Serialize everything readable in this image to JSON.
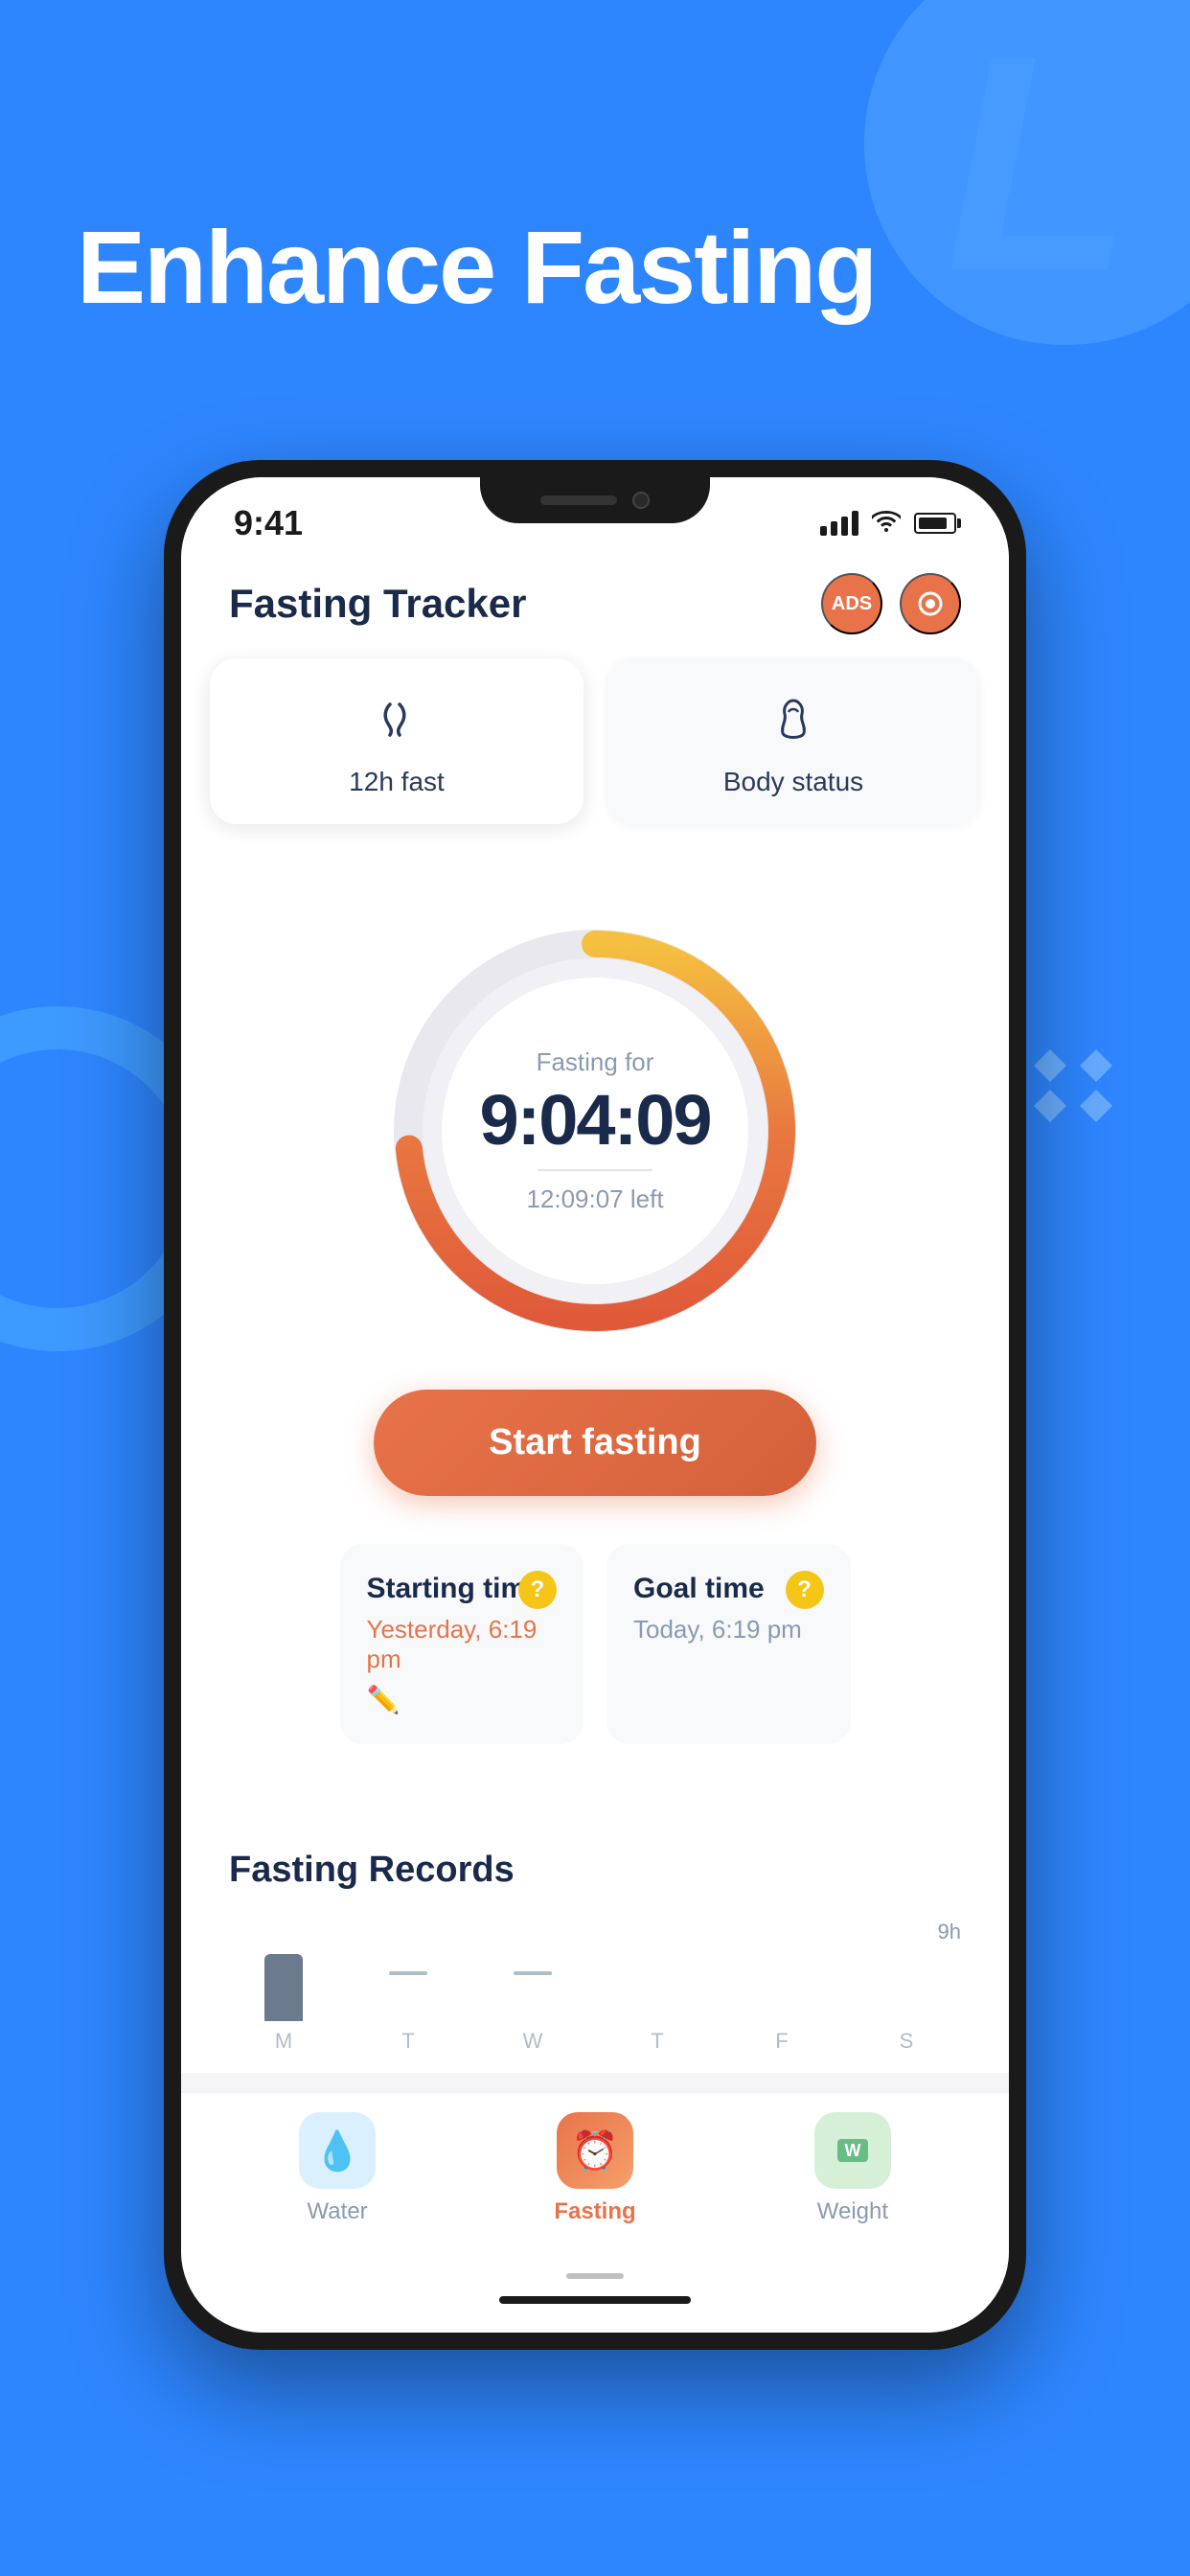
{
  "page": {
    "background_color": "#2E86FF",
    "title": "Enhance Fasting"
  },
  "header": {
    "app_title": "Fasting Tracker",
    "ads_button_label": "ADS",
    "record_button_label": "○"
  },
  "status_bar": {
    "time": "9:41",
    "signal": "●●●●",
    "wifi": "wifi",
    "battery": "battery"
  },
  "tabs": [
    {
      "id": "fast",
      "label": "12h fast",
      "icon": "⌛",
      "active": true
    },
    {
      "id": "body",
      "label": "Body status",
      "icon": "🌿",
      "active": false
    }
  ],
  "timer": {
    "label": "Fasting for",
    "time": "9:04:09",
    "left_label": "12:09:07 left"
  },
  "start_button": {
    "label": "Start fasting"
  },
  "time_cards": [
    {
      "title": "Starting time",
      "value": "Yesterday, 6:19 pm",
      "value_type": "orange",
      "has_edit": true,
      "has_question": true
    },
    {
      "title": "Goal time",
      "value": "Today, 6:19 pm",
      "value_type": "gray",
      "has_edit": false,
      "has_question": true
    }
  ],
  "records": {
    "title": "Fasting Records",
    "chart_label": "9h",
    "days": [
      {
        "label": "M",
        "height": 70,
        "type": "filled"
      },
      {
        "label": "T",
        "height": 0,
        "type": "line"
      },
      {
        "label": "W",
        "height": 0,
        "type": "line"
      },
      {
        "label": "T",
        "height": 0,
        "type": "none"
      },
      {
        "label": "F",
        "height": 0,
        "type": "none"
      },
      {
        "label": "S",
        "height": 0,
        "type": "none"
      }
    ]
  },
  "bottom_nav": [
    {
      "id": "water",
      "label": "Water",
      "icon": "💧",
      "color_class": "nav-icon-water",
      "active": false
    },
    {
      "id": "fasting",
      "label": "Fasting",
      "icon": "⏰",
      "color_class": "nav-icon-fasting",
      "active": true
    },
    {
      "id": "weight",
      "label": "Weight",
      "icon": "💬",
      "color_class": "nav-icon-weight",
      "active": false
    }
  ]
}
